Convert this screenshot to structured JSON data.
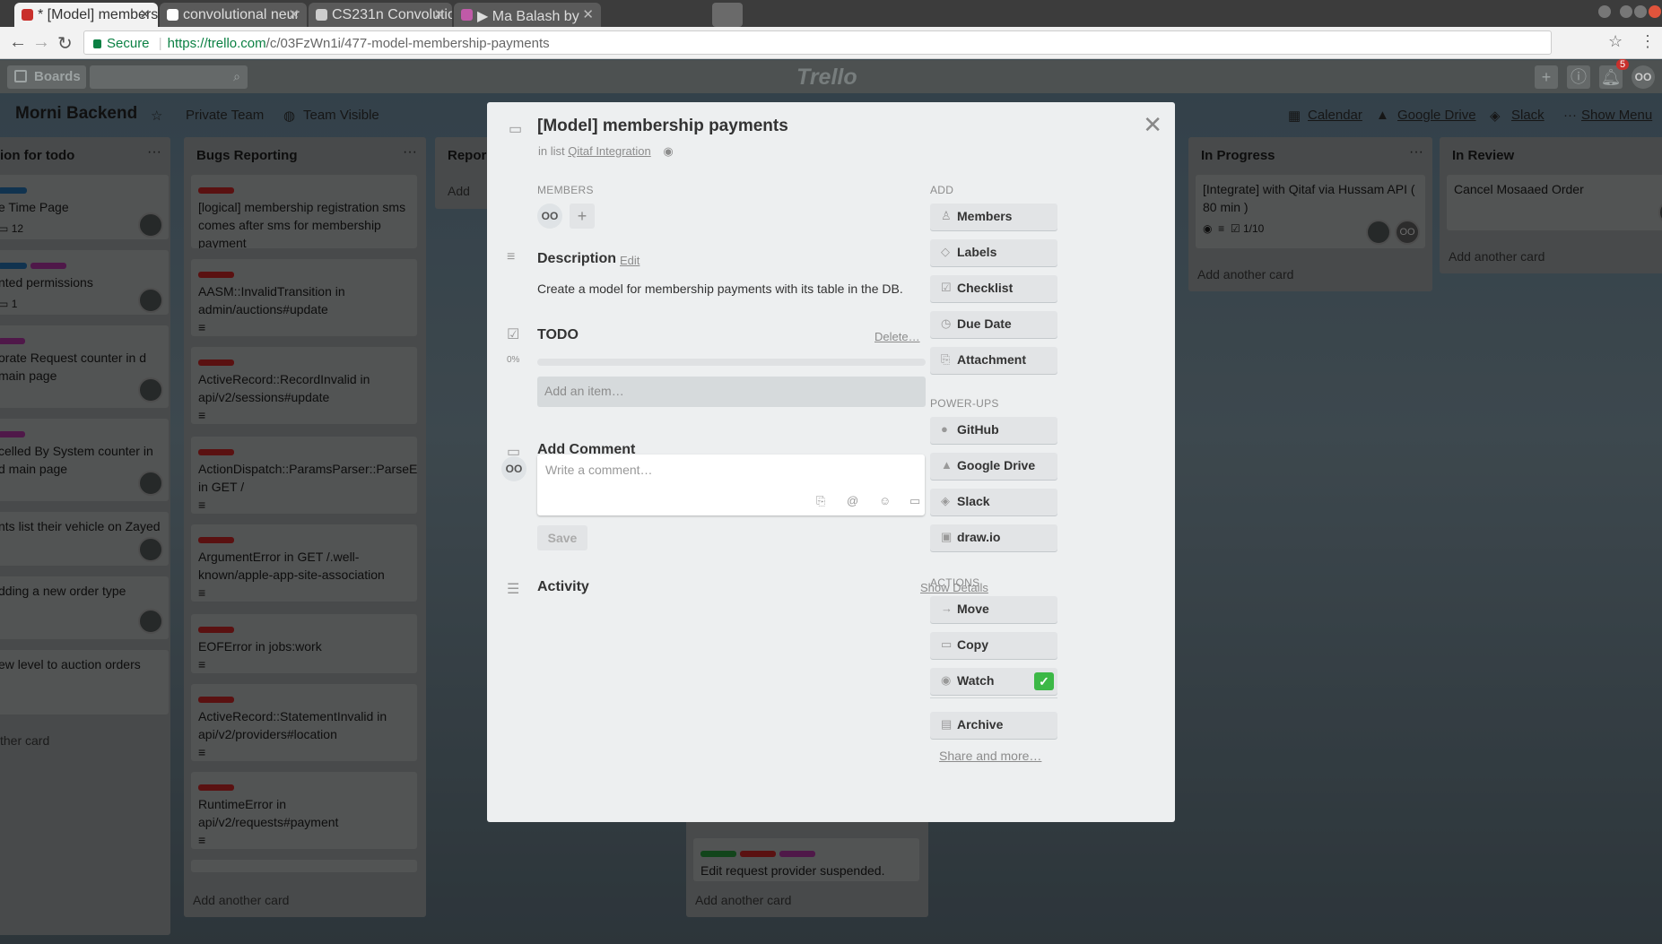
{
  "browser": {
    "tabs": [
      {
        "title": "* [Model] members",
        "active": true
      },
      {
        "title": "convolutional neur",
        "active": false
      },
      {
        "title": "CS231n Convolutio",
        "active": false
      },
      {
        "title": "▶ Ma Balash by ",
        "active": false
      }
    ],
    "secure_label": "Secure",
    "url_domain": "https://trello.com",
    "url_path": "/c/03FzWn1i/477-model-membership-payments"
  },
  "trello_header": {
    "boards_label": "Boards",
    "logo_text": "Trello",
    "notification_count": "5",
    "user_initials": "OO"
  },
  "board": {
    "title": "Morni Backend",
    "team": "Private Team",
    "visibility": "Team Visible",
    "calendar": "Calendar",
    "google_drive": "Google Drive",
    "slack": "Slack",
    "show_menu": "Show Menu",
    "lists": [
      {
        "title": "ion for todo",
        "cards": [
          "e Time Page",
          "nted permissions",
          "orate Request counter in d main page",
          "celled By System counter in d main page",
          "nts list their vehicle on Zayed",
          "dding a new order type",
          "ew level to auction orders"
        ],
        "add": "ther card",
        "comment_counts": [
          "12",
          "1"
        ]
      },
      {
        "title": "Bugs Reporting",
        "cards": [
          "[logical] membership registration sms comes after sms for membership payment",
          "AASM::InvalidTransition in admin/auctions#update",
          "ActiveRecord::RecordInvalid in api/v2/sessions#update",
          "ActionDispatch::ParamsParser::ParseError in GET /",
          "ArgumentError in GET /.well-known/apple-app-site-association",
          "EOFError in jobs:work",
          "ActiveRecord::StatementInvalid in api/v2/providers#location",
          "RuntimeError in api/v2/requests#payment"
        ],
        "add": "Add another card"
      },
      {
        "title": "Repor",
        "add": "Add"
      },
      {
        "title": "",
        "cards": [
          "Edit request provider suspended."
        ],
        "add": "Add another card"
      },
      {
        "title": "In Progress",
        "cards": [
          "[Integrate] with Qitaf via Hussam API ( 80 min )"
        ],
        "checklist": "1/10",
        "add": "Add another card"
      },
      {
        "title": "In Review",
        "cards": [
          "Cancel Mosaaed Order"
        ],
        "add": "Add another card"
      }
    ]
  },
  "modal": {
    "title": "[Model] membership payments",
    "in_list_prefix": "in list",
    "list_name": "Qitaf Integration",
    "members_heading": "Members",
    "member_initials": "OO",
    "add_member": "+",
    "description_heading": "Description",
    "edit_label": "Edit",
    "description": "Create a model for membership payments with its table in the DB.",
    "checklist_title": "TODO",
    "delete_label": "Delete…",
    "progress_percent": "0%",
    "progress": 0,
    "add_item_placeholder": "Add an item…",
    "comment_heading": "Add Comment",
    "comment_placeholder": "Write a comment…",
    "commenter_initials": "OO",
    "save_label": "Save",
    "activity_heading": "Activity",
    "show_details": "Show Details",
    "add_heading": "Add",
    "add_buttons": [
      "Members",
      "Labels",
      "Checklist",
      "Due Date",
      "Attachment"
    ],
    "powerups_heading": "Power-Ups",
    "powerup_buttons": [
      "GitHub",
      "Google Drive",
      "Slack",
      "draw.io"
    ],
    "actions_heading": "Actions",
    "action_buttons": [
      "Move",
      "Copy",
      "Watch",
      "Archive"
    ],
    "share_more": "Share and more…"
  },
  "colors": {
    "accent_green": "#5aac44",
    "watch_green": "#3cb846",
    "label_red": "#eb5a46",
    "label_green": "#61bd4f",
    "label_purple": "#c377e0",
    "label_blue": "#0079bf"
  }
}
